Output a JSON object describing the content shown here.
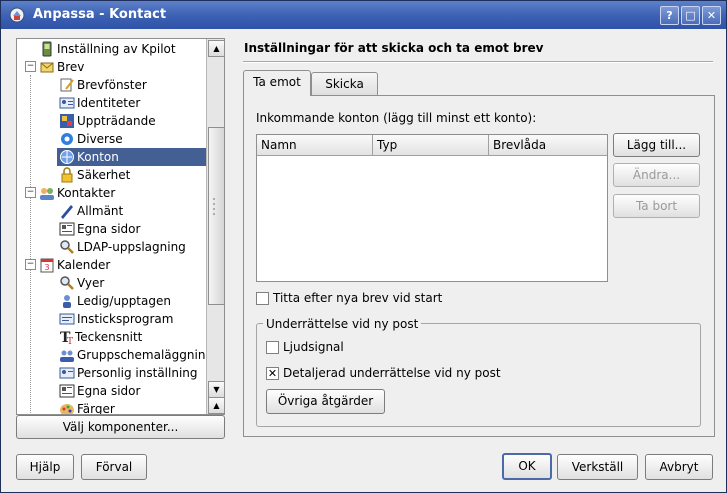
{
  "window": {
    "title": "Anpassa - Kontact"
  },
  "titlebar": {
    "help": "?",
    "maximize": "□",
    "close": "✕"
  },
  "tree": {
    "items": [
      {
        "label": "Inställning av Kpilot"
      },
      {
        "label": "Brev",
        "expander": "−"
      },
      {
        "label": "Brevfönster"
      },
      {
        "label": "Identiteter"
      },
      {
        "label": "Uppträdande"
      },
      {
        "label": "Diverse"
      },
      {
        "label": "Konton",
        "selected": true
      },
      {
        "label": "Säkerhet"
      },
      {
        "label": "Kontakter",
        "expander": "−"
      },
      {
        "label": "Allmänt"
      },
      {
        "label": "Egna sidor"
      },
      {
        "label": "LDAP-uppslagning"
      },
      {
        "label": "Kalender",
        "expander": "−"
      },
      {
        "label": "Vyer"
      },
      {
        "label": "Ledig/upptagen"
      },
      {
        "label": "Insticksprogram"
      },
      {
        "label": "Teckensnitt"
      },
      {
        "label": "Gruppschemaläggning"
      },
      {
        "label": "Personlig inställning"
      },
      {
        "label": "Egna sidor"
      },
      {
        "label": "Färger"
      }
    ],
    "select_components": "Välj komponenter..."
  },
  "main": {
    "heading": "Inställningar för att skicka och ta emot brev",
    "tabs": [
      {
        "label": "Ta emot"
      },
      {
        "label": "Skicka"
      }
    ],
    "incoming_label": "Inkommande konton (lägg till minst ett konto):",
    "columns": [
      "Namn",
      "Typ",
      "Brevlåda"
    ],
    "buttons": {
      "add": "Lägg till...",
      "modify": "Ändra...",
      "remove": "Ta bort"
    },
    "check_on_start": {
      "label": "Titta efter nya brev vid start",
      "checked": false
    },
    "group": {
      "title": "Underrättelse vid ny post",
      "beep": {
        "label": "Ljudsignal",
        "checked": false
      },
      "detailed": {
        "label": "Detaljerad underrättelse vid ny post",
        "checked": true,
        "mark": "✕"
      },
      "other_actions": "Övriga åtgärder"
    }
  },
  "footer": {
    "help": "Hjälp",
    "default": "Förval",
    "ok": "OK",
    "apply": "Verkställ",
    "cancel": "Avbryt"
  }
}
